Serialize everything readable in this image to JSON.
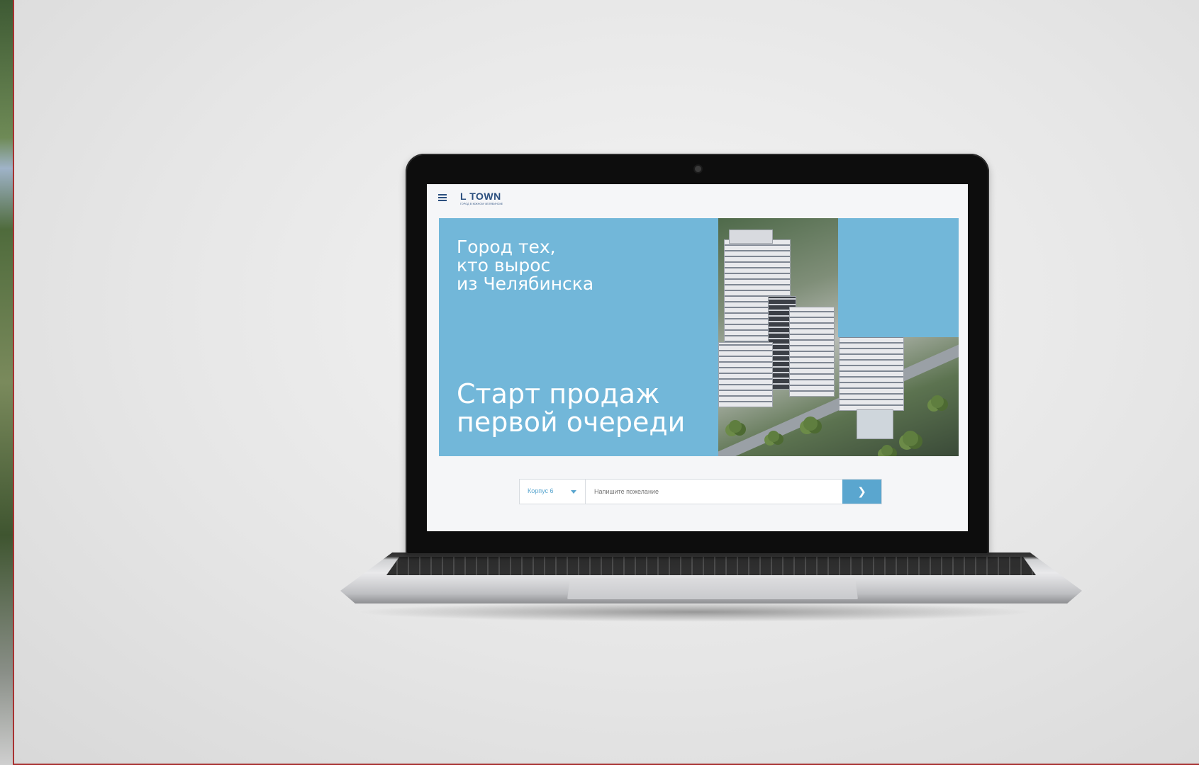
{
  "site": {
    "logo_text": "L TOWN",
    "logo_subtitle": "ГОРОД В ЮЖНОМ ЧЕЛЯБИНСКЕ"
  },
  "hero": {
    "tagline": "Город тех,\nкто вырос\nиз Челябинска",
    "headline": "Старт продаж\nпервой очереди",
    "accent_color": "#72b7d9"
  },
  "search": {
    "select_value": "Корпус 6",
    "input_placeholder": "Напишите пожелание",
    "submit_icon": "chevron-right-icon",
    "accent_color": "#5aa6cf"
  },
  "icons": {
    "menu": "hamburger-menu-icon",
    "camera": "webcam-icon"
  }
}
